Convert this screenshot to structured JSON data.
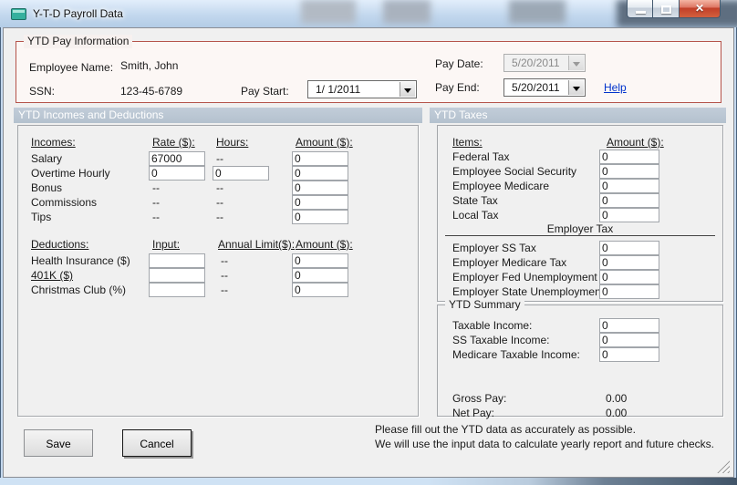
{
  "window": {
    "title": "Y-T-D Payroll Data",
    "controls": {
      "close_glyph": "✕"
    }
  },
  "pay_info": {
    "group_label": "YTD Pay Information",
    "employee_name_label": "Employee Name:",
    "employee_name": "Smith, John",
    "ssn_label": "SSN:",
    "ssn": "123-45-6789",
    "pay_start_label": "Pay Start:",
    "pay_start": "1/ 1/2011",
    "pay_date_label": "Pay Date:",
    "pay_date": "5/20/2011",
    "pay_end_label": "Pay End:",
    "pay_end": "5/20/2011",
    "help_label": "Help"
  },
  "left": {
    "section_title": "YTD Incomes and Deductions",
    "incomes_headers": {
      "c1": "Incomes:",
      "c2": "Rate ($):",
      "c3": "Hours:",
      "c4": "Amount ($):"
    },
    "incomes": [
      {
        "label": "Salary",
        "rate": "67000",
        "hours": "--",
        "amount": "0"
      },
      {
        "label": "Overtime Hourly",
        "rate": "0",
        "hours": "0",
        "amount": "0"
      },
      {
        "label": "Bonus",
        "rate": "--",
        "hours": "--",
        "amount": "0"
      },
      {
        "label": "Commissions",
        "rate": "--",
        "hours": "--",
        "amount": "0"
      },
      {
        "label": "Tips",
        "rate": "--",
        "hours": "--",
        "amount": "0"
      }
    ],
    "deductions_headers": {
      "c1": "Deductions:",
      "c2": "Input:",
      "c3": "Annual Limit($):",
      "c4": "Amount ($):"
    },
    "deductions": [
      {
        "label": "Health Insurance  ($)",
        "input": "",
        "limit": "--",
        "amount": "0"
      },
      {
        "label": "401K  ($)",
        "input": "",
        "limit": "--",
        "amount": "0"
      },
      {
        "label": "Christmas Club  (%)",
        "input": "",
        "limit": "--",
        "amount": "0"
      }
    ]
  },
  "taxes": {
    "section_title": "YTD Taxes",
    "headers": {
      "c1": "Items:",
      "c2": "Amount ($):"
    },
    "employee": [
      {
        "label": "Federal Tax",
        "amount": "0"
      },
      {
        "label": "Employee Social Security",
        "amount": "0"
      },
      {
        "label": "Employee Medicare",
        "amount": "0"
      },
      {
        "label": "State Tax",
        "amount": "0"
      },
      {
        "label": "Local Tax",
        "amount": "0"
      }
    ],
    "employer_divider": "Employer Tax",
    "employer": [
      {
        "label": "Employer SS Tax",
        "amount": "0"
      },
      {
        "label": "Employer Medicare Tax",
        "amount": "0"
      },
      {
        "label": "Employer Fed Unemployment",
        "amount": "0"
      },
      {
        "label": "Employer State Unemployment",
        "amount": "0"
      }
    ]
  },
  "summary": {
    "group_label": "YTD Summary",
    "rows": [
      {
        "label": "Taxable Income:",
        "value": "0"
      },
      {
        "label": "SS Taxable Income:",
        "value": "0"
      },
      {
        "label": "Medicare Taxable Income:",
        "value": "0"
      }
    ],
    "gross_pay_label": "Gross Pay:",
    "gross_pay": "0.00",
    "net_pay_label": "Net Pay:",
    "net_pay": "0.00"
  },
  "footer": {
    "save_label": "Save",
    "cancel_label": "Cancel",
    "note_line1": "Please fill out the YTD data as accurately as possible.",
    "note_line2": "We will use the input data to calculate yearly report and future checks."
  },
  "colors": {
    "pay_info_border": "#b5544b",
    "section_header_bg": "#b9c5d2",
    "help_link": "#0033cc",
    "close_button": "#c13e28",
    "titlebar": "#c3d8ee",
    "app_icon": "#35b09e"
  }
}
